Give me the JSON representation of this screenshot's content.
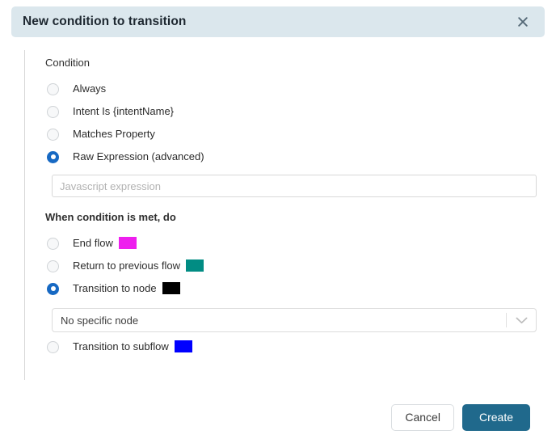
{
  "dialog": {
    "title": "New condition to transition",
    "close_icon": "close-icon"
  },
  "condition_section": {
    "label": "Condition",
    "options": [
      {
        "label": "Always",
        "selected": false
      },
      {
        "label": "Intent Is {intentName}",
        "selected": false
      },
      {
        "label": "Matches Property",
        "selected": false
      },
      {
        "label": "Raw Expression (advanced)",
        "selected": true
      }
    ]
  },
  "expression_input": {
    "value": "",
    "placeholder": "Javascript expression"
  },
  "action_section": {
    "label": "When condition is met, do",
    "options": [
      {
        "label": "End flow",
        "selected": false,
        "swatch": "#ee1fee"
      },
      {
        "label": "Return to previous flow",
        "selected": false,
        "swatch": "#018c83"
      },
      {
        "label": "Transition to node",
        "selected": true,
        "swatch": "#000000"
      },
      {
        "label": "Transition to subflow",
        "selected": false,
        "swatch": "#0000ff"
      }
    ]
  },
  "node_select": {
    "value": "No specific node",
    "arrow_icon": "chevron-down-icon"
  },
  "footer": {
    "cancel_label": "Cancel",
    "create_label": "Create"
  },
  "colors": {
    "header_bg": "#dbe7ed",
    "radio_selected": "#1769c3",
    "primary_button": "#20698c"
  }
}
